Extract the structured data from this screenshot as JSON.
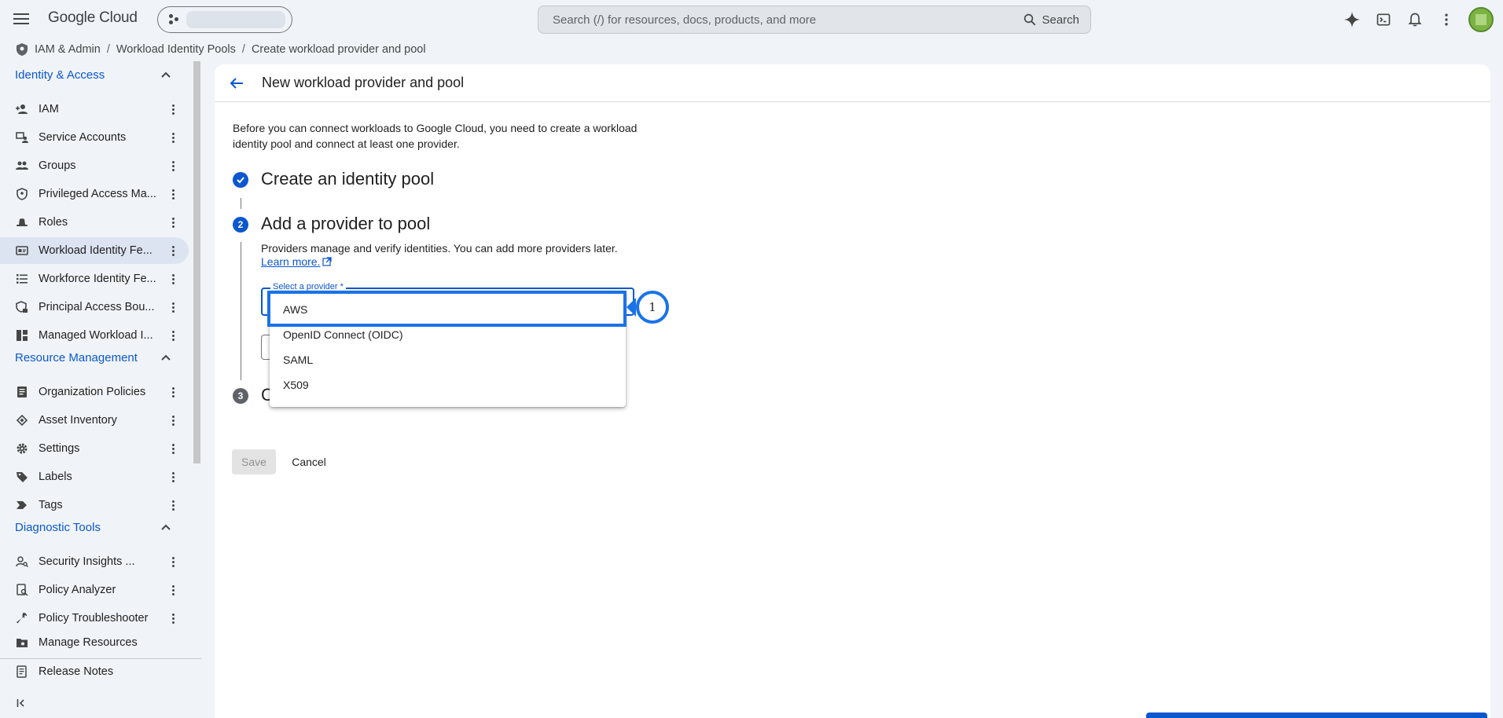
{
  "topbar": {
    "logo": "Google Cloud",
    "search_placeholder": "Search (/) for resources, docs, products, and more",
    "search_button": "Search"
  },
  "breadcrumb": [
    "IAM & Admin",
    "Workload Identity Pools",
    "Create workload provider and pool"
  ],
  "sidebar": {
    "sections": {
      "identity": "Identity & Access",
      "resource": "Resource Management",
      "diagnostic": "Diagnostic Tools"
    },
    "items": [
      {
        "label": "IAM",
        "icon": "person-add-icon"
      },
      {
        "label": "Service Accounts",
        "icon": "service-account-icon"
      },
      {
        "label": "Groups",
        "icon": "groups-icon"
      },
      {
        "label": "Privileged Access Ma...",
        "icon": "shield-icon"
      },
      {
        "label": "Roles",
        "icon": "hat-icon"
      },
      {
        "label": "Workload Identity Fe...",
        "icon": "id-card-icon"
      },
      {
        "label": "Workforce Identity Fe...",
        "icon": "list-icon"
      },
      {
        "label": "Principal Access Bou...",
        "icon": "shield-lock-icon"
      },
      {
        "label": "Managed Workload I...",
        "icon": "dashboard-icon"
      },
      {
        "label": "Organization Policies",
        "icon": "document-icon"
      },
      {
        "label": "Asset Inventory",
        "icon": "layers-icon"
      },
      {
        "label": "Settings",
        "icon": "gear-icon"
      },
      {
        "label": "Labels",
        "icon": "label-icon"
      },
      {
        "label": "Tags",
        "icon": "tag-icon"
      },
      {
        "label": "Security Insights ...",
        "icon": "person-search-icon"
      },
      {
        "label": "Policy Analyzer",
        "icon": "document-search-icon"
      },
      {
        "label": "Policy Troubleshooter",
        "icon": "wrench-icon"
      },
      {
        "label": "Manage Resources",
        "icon": "folder-gear-icon"
      },
      {
        "label": "Release Notes",
        "icon": "notes-icon"
      }
    ]
  },
  "main": {
    "title": "New workload provider and pool",
    "intro": "Before you can connect workloads to Google Cloud, you need to create a workload identity pool and connect at least one provider.",
    "step1": {
      "title": "Create an identity pool"
    },
    "step2": {
      "number": "2",
      "title": "Add a provider to pool",
      "desc": "Providers manage and verify identities. You can add more providers later.",
      "learn_more": "Learn more.",
      "field_label": "Select a provider *"
    },
    "step3": {
      "number": "3",
      "letter": "C"
    },
    "save": "Save",
    "cancel": "Cancel"
  },
  "dropdown": {
    "options": [
      "AWS",
      "OpenID Connect (OIDC)",
      "SAML",
      "X509"
    ]
  },
  "callout": {
    "number": "1"
  },
  "colors": {
    "accent": "#0b57d0",
    "highlight": "#1a73e8",
    "active_nav": "#dce4f2"
  }
}
